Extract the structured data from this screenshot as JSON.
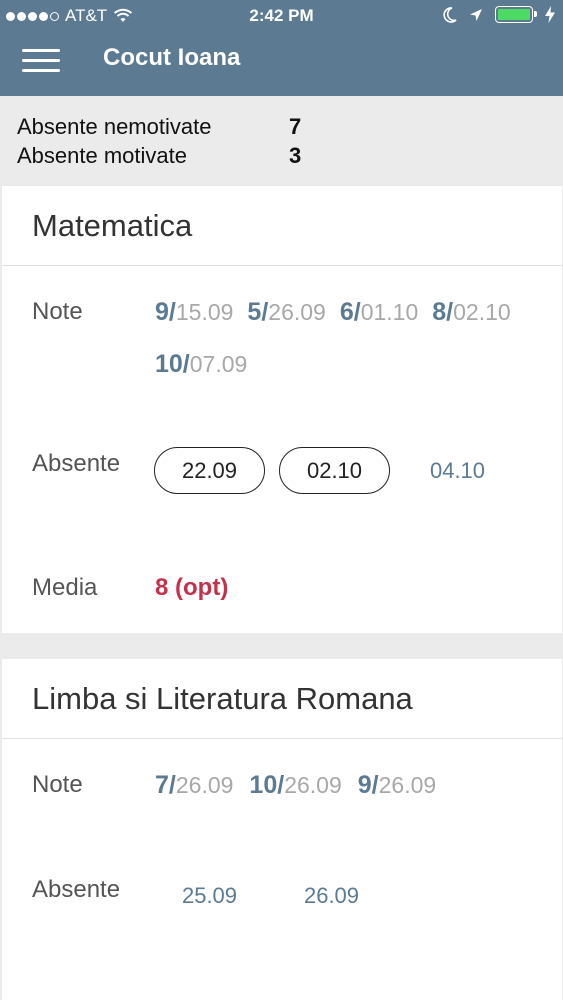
{
  "status_bar": {
    "carrier": "AT&T",
    "time": "2:42 PM"
  },
  "header": {
    "title": "Cocut Ioana"
  },
  "summary": {
    "unexcused_label": "Absente nemotivate",
    "unexcused_value": "7",
    "excused_label": "Absente motivate",
    "excused_value": "3"
  },
  "subjects": [
    {
      "name": "Matematica",
      "grades_label": "Note",
      "grades": [
        {
          "value": "9/",
          "date": "15.09"
        },
        {
          "value": "5/",
          "date": "26.09"
        },
        {
          "value": "6/",
          "date": "01.10"
        },
        {
          "value": "8/",
          "date": "02.10"
        },
        {
          "value": "10/",
          "date": "07.09"
        }
      ],
      "absences_label": "Absente",
      "absences": [
        {
          "date": "22.09",
          "excused": true
        },
        {
          "date": "02.10",
          "excused": true
        },
        {
          "date": "04.10",
          "excused": false
        }
      ],
      "average_label": "Media",
      "average": "8 (opt)"
    },
    {
      "name": "Limba si Literatura Romana",
      "grades_label": "Note",
      "grades": [
        {
          "value": "7/",
          "date": "26.09"
        },
        {
          "value": "10/",
          "date": "26.09"
        },
        {
          "value": "9/",
          "date": "26.09"
        }
      ],
      "absences_label": "Absente",
      "absences": [
        {
          "date": "25.09",
          "excused": false
        },
        {
          "date": "26.09",
          "excused": false
        }
      ]
    }
  ],
  "colors": {
    "header_bg": "#5c7b93",
    "grade_value": "#5c7b93",
    "grade_date": "#a8a8a8",
    "average": "#c4314b",
    "battery": "#4cd964"
  },
  "icons": [
    "signal-dots-icon",
    "wifi-icon",
    "moon-icon",
    "location-arrow-icon",
    "battery-icon",
    "charging-bolt-icon",
    "hamburger-menu-icon"
  ]
}
